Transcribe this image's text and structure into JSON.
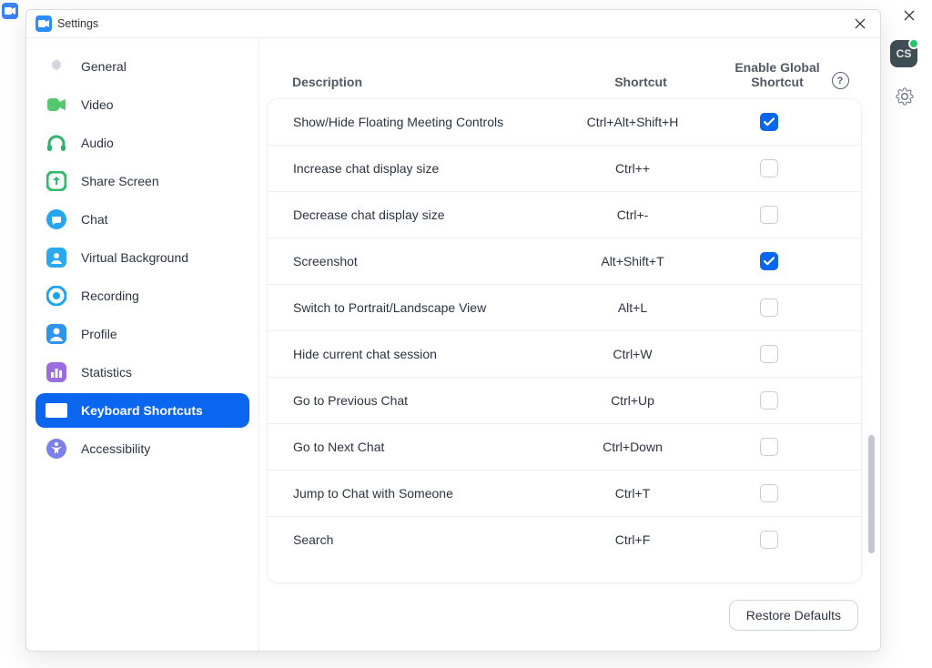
{
  "window": {
    "title": "Settings",
    "restore_defaults": "Restore Defaults"
  },
  "background": {
    "avatar": "CS"
  },
  "sidebar": {
    "items": [
      {
        "label": "General"
      },
      {
        "label": "Video"
      },
      {
        "label": "Audio"
      },
      {
        "label": "Share Screen"
      },
      {
        "label": "Chat"
      },
      {
        "label": "Virtual Background"
      },
      {
        "label": "Recording"
      },
      {
        "label": "Profile"
      },
      {
        "label": "Statistics"
      },
      {
        "label": "Keyboard Shortcuts"
      },
      {
        "label": "Accessibility"
      }
    ],
    "selected_index": 9
  },
  "headers": {
    "description": "Description",
    "shortcut": "Shortcut",
    "enable_global": "Enable Global Shortcut"
  },
  "rows": [
    {
      "desc": "Show/Hide Floating Meeting Controls",
      "shortcut": "Ctrl+Alt+Shift+H",
      "enabled": true
    },
    {
      "desc": "Increase chat display size",
      "shortcut": "Ctrl++",
      "enabled": false
    },
    {
      "desc": "Decrease chat display size",
      "shortcut": "Ctrl+-",
      "enabled": false
    },
    {
      "desc": "Screenshot",
      "shortcut": "Alt+Shift+T",
      "enabled": true
    },
    {
      "desc": "Switch to Portrait/Landscape View",
      "shortcut": "Alt+L",
      "enabled": false
    },
    {
      "desc": "Hide current chat session",
      "shortcut": "Ctrl+W",
      "enabled": false
    },
    {
      "desc": "Go to Previous Chat",
      "shortcut": "Ctrl+Up",
      "enabled": false
    },
    {
      "desc": "Go to Next Chat",
      "shortcut": "Ctrl+Down",
      "enabled": false
    },
    {
      "desc": "Jump to Chat with Someone",
      "shortcut": "Ctrl+T",
      "enabled": false
    },
    {
      "desc": "Search",
      "shortcut": "Ctrl+F",
      "enabled": false
    }
  ]
}
